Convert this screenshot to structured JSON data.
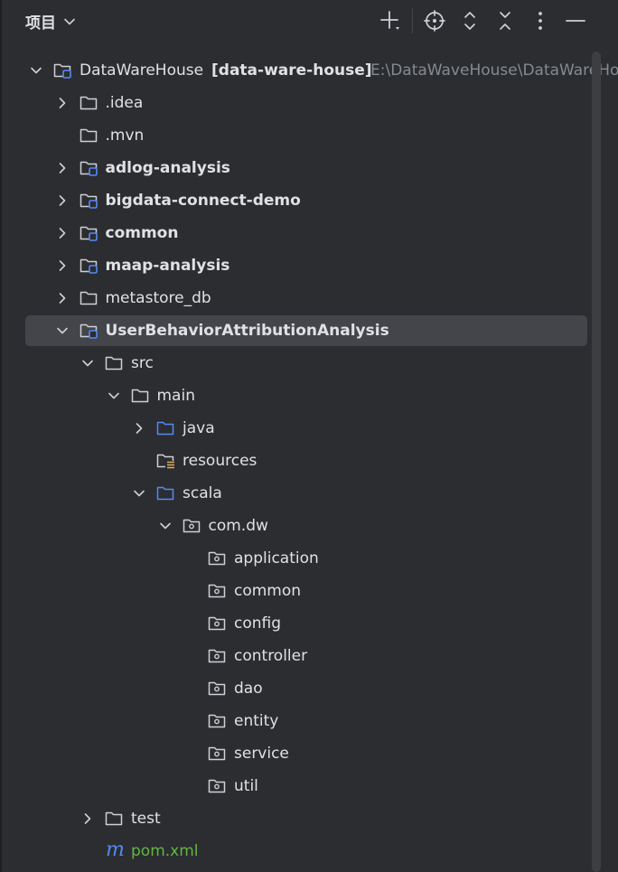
{
  "header": {
    "title": "项目",
    "tools": [
      "add-icon",
      "locate-icon",
      "expand-all-icon",
      "collapse-all-icon",
      "more-icon",
      "hide-icon"
    ]
  },
  "colors": {
    "background": "#2b2d30",
    "selection": "#43454a",
    "text": "#dfe1e5",
    "muted": "#868a91",
    "folder_blue": "#548af7",
    "module_badge": "#548af7",
    "pom_green": "#62b543"
  },
  "tree": {
    "root": {
      "label": "DataWareHouse",
      "module": "[data-ware-house]",
      "path": "E:\\DataWaveHouse\\DataWareHouse"
    },
    "items": [
      {
        "label": ".idea"
      },
      {
        "label": ".mvn"
      },
      {
        "label": "adlog-analysis"
      },
      {
        "label": "bigdata-connect-demo"
      },
      {
        "label": "common"
      },
      {
        "label": "maap-analysis"
      },
      {
        "label": "metastore_db"
      },
      {
        "label": "UserBehaviorAttributionAnalysis"
      },
      {
        "label": "src"
      },
      {
        "label": "main"
      },
      {
        "label": "java"
      },
      {
        "label": "resources"
      },
      {
        "label": "scala"
      },
      {
        "label": "com.dw"
      },
      {
        "label": "application"
      },
      {
        "label": "common"
      },
      {
        "label": "config"
      },
      {
        "label": "controller"
      },
      {
        "label": "dao"
      },
      {
        "label": "entity"
      },
      {
        "label": "service"
      },
      {
        "label": "util"
      },
      {
        "label": "test"
      },
      {
        "label": "pom.xml",
        "icon_letter": "m"
      }
    ]
  }
}
